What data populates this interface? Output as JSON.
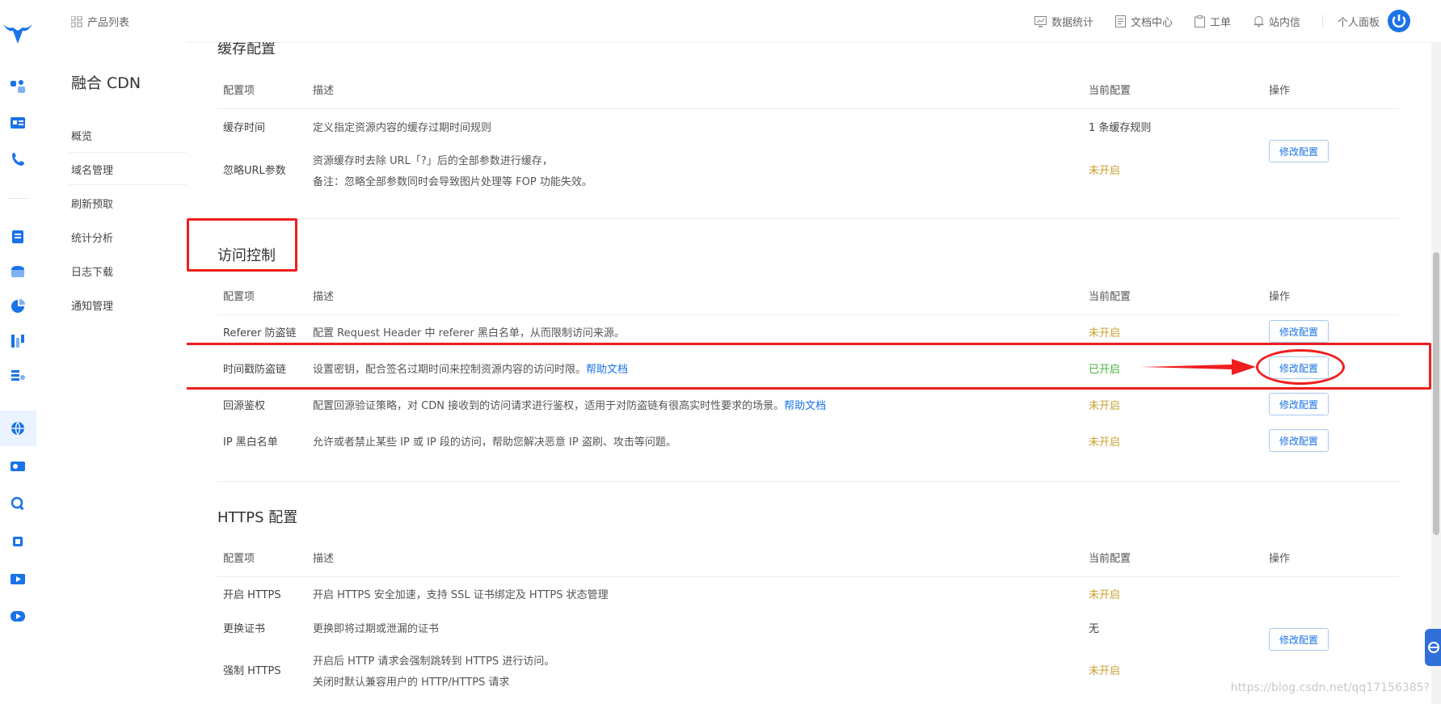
{
  "topbar": {
    "product_list": "产品列表",
    "data_stats": "数据统计",
    "doc_center": "文档中心",
    "ticket": "工单",
    "inbox": "站内信",
    "personal_panel": "个人面板"
  },
  "subnav": {
    "product_name": "融合 CDN",
    "items": [
      "概览",
      "域名管理",
      "刷新预取",
      "统计分析",
      "日志下载",
      "通知管理"
    ]
  },
  "columns": {
    "item": "配置项",
    "desc": "描述",
    "current": "当前配置",
    "action": "操作"
  },
  "cache": {
    "title": "缓存配置",
    "rows": [
      {
        "name": "缓存时间",
        "desc": "定义指定资源内容的缓存过期时间规则",
        "current": "1 条缓存规则"
      },
      {
        "name": "忽略URL参数",
        "desc1": "资源缓存时去除 URL「?」后的全部参数进行缓存，",
        "desc2": "备注：忽略全部参数同时会导致图片处理等 FOP 功能失效。",
        "current": "未开启"
      }
    ],
    "button": "修改配置"
  },
  "access": {
    "title": "访问控制",
    "rows": [
      {
        "name": "Referer 防盗链",
        "desc": "配置 Request Header 中 referer 黑白名单，从而限制访问来源。",
        "current": "未开启",
        "button": "修改配置"
      },
      {
        "name": "时间戳防盗链",
        "desc": "设置密钥，配合签名过期时间来控制资源内容的访问时限。",
        "link": "帮助文档",
        "current": "已开启",
        "button": "修改配置"
      },
      {
        "name": "回源鉴权",
        "desc": "配置回源验证策略，对 CDN 接收到的访问请求进行鉴权，适用于对防盗链有很高实时性要求的场景。",
        "link": "帮助文档",
        "current": "未开启",
        "button": "修改配置"
      },
      {
        "name": "IP 黑白名单",
        "desc": "允许或者禁止某些 IP 或 IP 段的访问，帮助您解决恶意 IP 盗刷、攻击等问题。",
        "current": "未开启",
        "button": "修改配置"
      }
    ]
  },
  "https": {
    "title": "HTTPS 配置",
    "rows": [
      {
        "name": "开启 HTTPS",
        "desc": "开启 HTTPS 安全加速，支持 SSL 证书绑定及 HTTPS 状态管理",
        "current": "未开启"
      },
      {
        "name": "更换证书",
        "desc": "更换即将过期或泄漏的证书",
        "current": "无"
      },
      {
        "name": "强制 HTTPS",
        "desc1": "开启后 HTTP 请求会强制跳转到 HTTPS 进行访问。",
        "desc2": "关闭时默认兼容用户的 HTTP/HTTPS 请求",
        "current": "未开启"
      }
    ],
    "button": "修改配置"
  },
  "watermark": "https://blog.csdn.net/qq17156385?",
  "colors": {
    "accent": "#1a73e8",
    "annotation_red": "#f01e1e",
    "status_on": "#46b63c",
    "status_off": "#c8a030"
  }
}
